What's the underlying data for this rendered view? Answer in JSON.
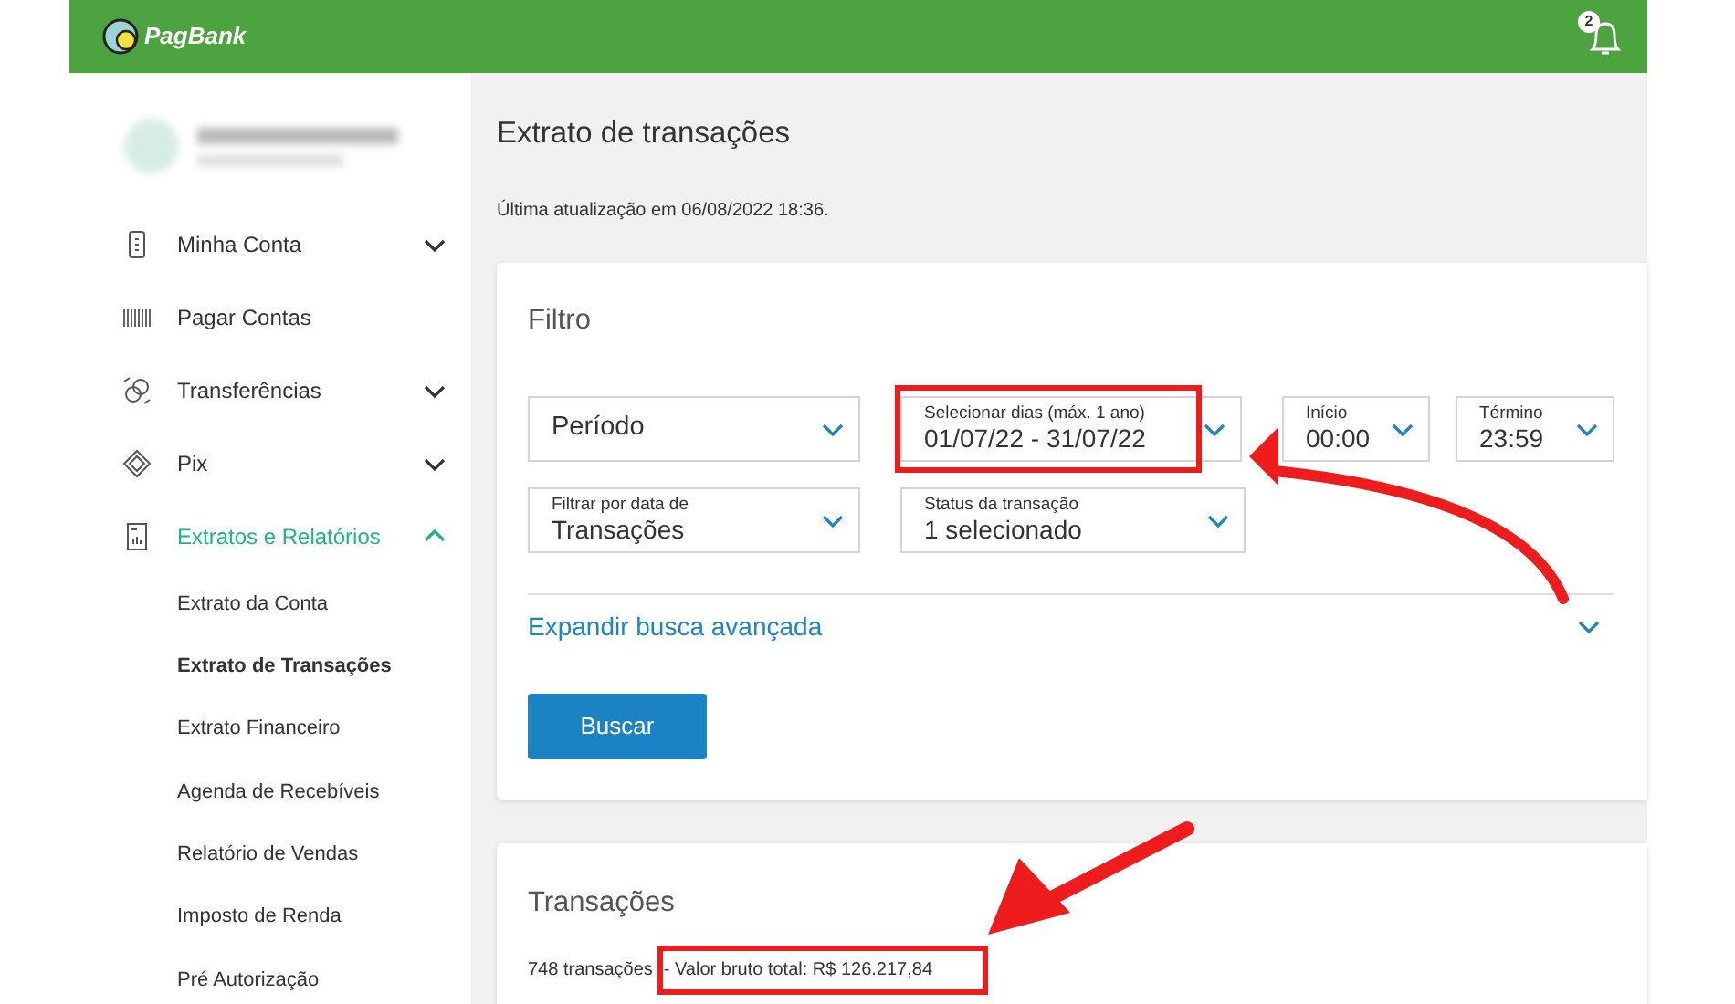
{
  "header": {
    "logo_text": "PagBank",
    "notification_count": "2"
  },
  "sidebar": {
    "items": [
      {
        "label": "Minha Conta",
        "expanded": false,
        "selected": false
      },
      {
        "label": "Pagar Contas",
        "selected": false
      },
      {
        "label": "Transferências",
        "expanded": false,
        "selected": false
      },
      {
        "label": "Pix",
        "expanded": false,
        "selected": false
      },
      {
        "label": "Extratos e Relatórios",
        "expanded": true,
        "selected": true,
        "children": [
          {
            "label": "Extrato da Conta",
            "selected": false
          },
          {
            "label": "Extrato de Transações",
            "selected": true
          },
          {
            "label": "Extrato Financeiro",
            "selected": false
          },
          {
            "label": "Agenda de Recebíveis",
            "selected": false
          },
          {
            "label": "Relatório de Vendas",
            "selected": false
          },
          {
            "label": "Imposto de Renda",
            "selected": false
          },
          {
            "label": "Pré Autorização",
            "selected": false
          }
        ]
      }
    ]
  },
  "main": {
    "title": "Extrato de transações",
    "updated": "Última atualização em 06/08/2022 18:36.",
    "filter": {
      "title": "Filtro",
      "rows": [
        [
          {
            "value": "Período",
            "highlighted": false
          },
          {
            "label": "Selecionar dias (máx. 1 ano)",
            "value": "01/07/22 - 31/07/22",
            "highlighted": true
          },
          {
            "label": "Início",
            "value": "00:00",
            "highlighted": false
          },
          {
            "label": "Término",
            "value": "23:59",
            "highlighted": false
          }
        ],
        [
          {
            "label": "Filtrar por data de",
            "value": "Transações",
            "highlighted": false
          },
          {
            "label": "Status da transação",
            "value": "1 selecionado",
            "highlighted": false
          }
        ]
      ],
      "advanced": {
        "label": "Expandir busca avançada",
        "expanded": false
      },
      "button": "Buscar"
    },
    "transactions": {
      "title": "Transações",
      "count": "748 transações",
      "total": "- Valor bruto total: R$ 126.217,84",
      "highlighted": true
    }
  }
}
